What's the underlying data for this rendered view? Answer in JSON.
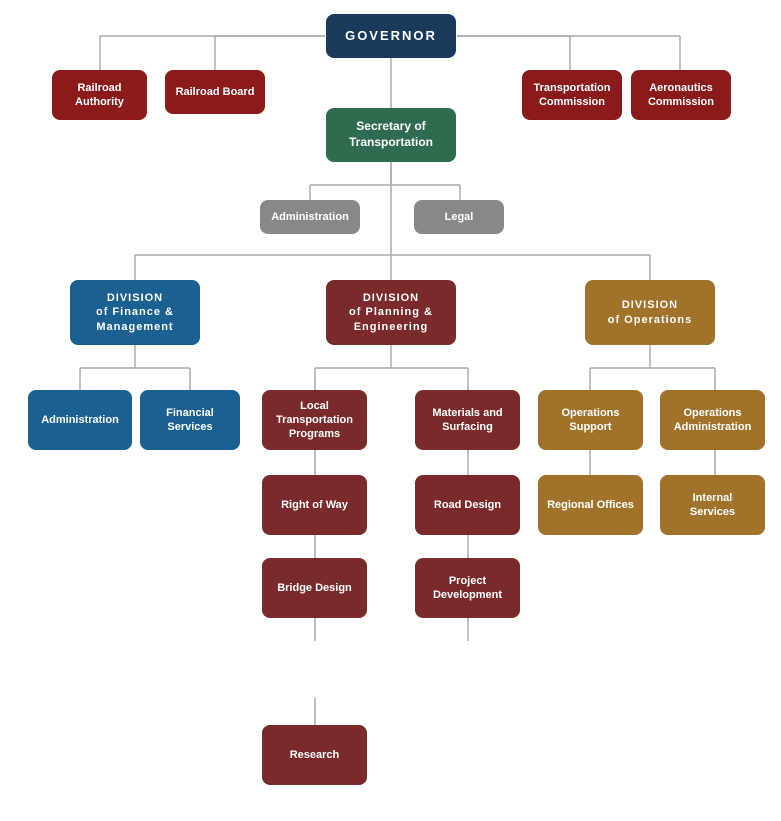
{
  "nodes": {
    "governor": {
      "label": "GOVERNOR"
    },
    "railroad_authority": {
      "label": "Railroad\nAuthority"
    },
    "railroad_board": {
      "label": "Railroad Board"
    },
    "transportation_commission": {
      "label": "Transportation\nCommission"
    },
    "aeronautics_commission": {
      "label": "Aeronautics\nCommission"
    },
    "secretary": {
      "label": "Secretary of\nTransportation"
    },
    "administration_staff": {
      "label": "Administration"
    },
    "legal": {
      "label": "Legal"
    },
    "div_finance": {
      "label": "DIVISION\nof Finance &\nManagement"
    },
    "div_planning": {
      "label": "DIVISION\nof Planning &\nEngineering"
    },
    "div_operations": {
      "label": "DIVISION\nof Operations"
    },
    "admin_sub": {
      "label": "Administration"
    },
    "financial_services": {
      "label": "Financial\nServices"
    },
    "local_transport": {
      "label": "Local\nTransportation\nPrograms"
    },
    "materials_surfacing": {
      "label": "Materials and\nSurfacing"
    },
    "operations_support": {
      "label": "Operations\nSupport"
    },
    "operations_admin": {
      "label": "Operations\nAdministration"
    },
    "right_of_way": {
      "label": "Right of Way"
    },
    "road_design": {
      "label": "Road Design"
    },
    "regional_offices": {
      "label": "Regional Offices"
    },
    "internal_services": {
      "label": "Internal\nServices"
    },
    "bridge_design": {
      "label": "Bridge Design"
    },
    "project_development": {
      "label": "Project\nDevelopment"
    },
    "research": {
      "label": "Research"
    }
  },
  "colors": {
    "governor": "#1a3a5c",
    "red": "#8b1a1a",
    "secretary": "#2e6b4f",
    "gray": "#888888",
    "div_blue": "#1a6090",
    "div_maroon": "#7a2a2a",
    "div_brown": "#a0722a",
    "connector": "#aaaaaa"
  }
}
